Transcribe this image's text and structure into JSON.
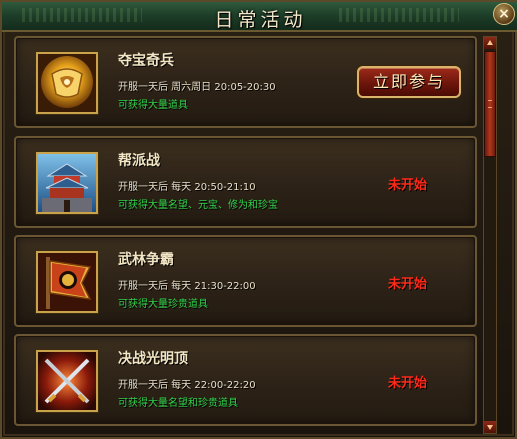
{
  "window": {
    "title": "日常活动",
    "close_label": "×"
  },
  "activities": [
    {
      "name": "夺宝奇兵",
      "time": "开服一天后 周六周日 20:05-20:30",
      "reward": "可获得大量道具",
      "action": "立即参与",
      "icon": "treasure-scroll-icon"
    },
    {
      "name": "帮派战",
      "time": "开服一天后 每天 20:50-21:10",
      "reward": "可获得大量名望、元宝、修为和珍宝",
      "status": "未开始",
      "icon": "pagoda-icon"
    },
    {
      "name": "武林争霸",
      "time": "开服一天后 每天 21:30-22:00",
      "reward": "可获得大量珍贵道具",
      "status": "未开始",
      "icon": "banner-flag-icon"
    },
    {
      "name": "决战光明顶",
      "time": "开服一天后 每天 22:00-22:20",
      "reward": "可获得大量名望和珍贵道具",
      "status": "未开始",
      "icon": "crossed-swords-icon"
    }
  ],
  "colors": {
    "reward_text": "#2fd24a",
    "status_text": "#ff2a1a",
    "title_bar": "#1e3f29",
    "frame_gold": "#c9a24c"
  }
}
